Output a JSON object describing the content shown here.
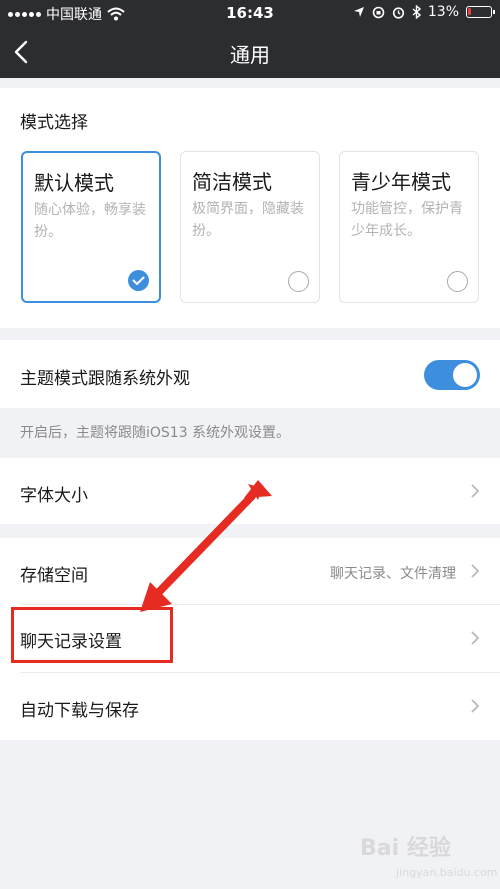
{
  "status_bar": {
    "carrier": "中国联通",
    "time": "16:43",
    "battery": "13%",
    "battery_level": 0.13
  },
  "nav": {
    "title": "通用"
  },
  "mode_section": {
    "title": "模式选择",
    "modes": [
      {
        "name": "默认模式",
        "desc": "随心体验，畅享装扮。",
        "selected": true
      },
      {
        "name": "简洁模式",
        "desc": "极简界面，隐藏装扮。",
        "selected": false
      },
      {
        "name": "青少年模式",
        "desc": "功能管控，保护青少年成长。",
        "selected": false
      }
    ]
  },
  "theme": {
    "label": "主题模式跟随系统外观",
    "enabled": true,
    "hint": "开启后，主题将跟随iOS13 系统外观设置。"
  },
  "font_size": {
    "label": "字体大小"
  },
  "storage": {
    "label": "存储空间",
    "value": "聊天记录、文件清理"
  },
  "chat_history": {
    "label": "聊天记录设置"
  },
  "auto_download": {
    "label": "自动下载与保存"
  },
  "watermark": {
    "text": "Bai  经验",
    "sub": "jingyan.baidu.com"
  },
  "colors": {
    "accent": "#3e8ede",
    "annotation_red": "#e52b22",
    "nav_bg": "#2c2d31"
  }
}
